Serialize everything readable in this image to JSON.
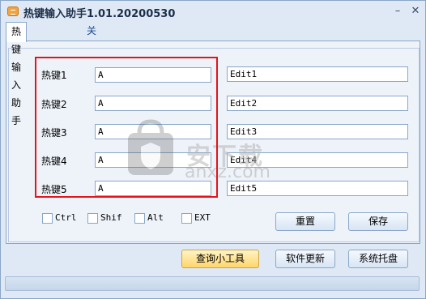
{
  "window": {
    "title": "热键输入助手1.01.20200530"
  },
  "tabs": [
    {
      "label": "热键输入助手"
    },
    {
      "label": "关于"
    }
  ],
  "hotkeys": [
    {
      "label": "热键1",
      "value": "A",
      "edit": "Edit1"
    },
    {
      "label": "热键2",
      "value": "A",
      "edit": "Edit2"
    },
    {
      "label": "热键3",
      "value": "A",
      "edit": "Edit3"
    },
    {
      "label": "热键4",
      "value": "A",
      "edit": "Edit4"
    },
    {
      "label": "热键5",
      "value": "A",
      "edit": "Edit5"
    }
  ],
  "modifiers": [
    {
      "label": "Ctrl"
    },
    {
      "label": "Shif"
    },
    {
      "label": "Alt"
    },
    {
      "label": "EXT"
    }
  ],
  "buttons": {
    "reset": "重置",
    "save": "保存",
    "query_tool": "查询小工具",
    "update": "软件更新",
    "tray": "系统托盘"
  },
  "watermark": {
    "text": "安下载",
    "url": "anxz.com"
  },
  "colors": {
    "highlight_border": "#e3141b",
    "window_bg": "#dfe9f5"
  }
}
